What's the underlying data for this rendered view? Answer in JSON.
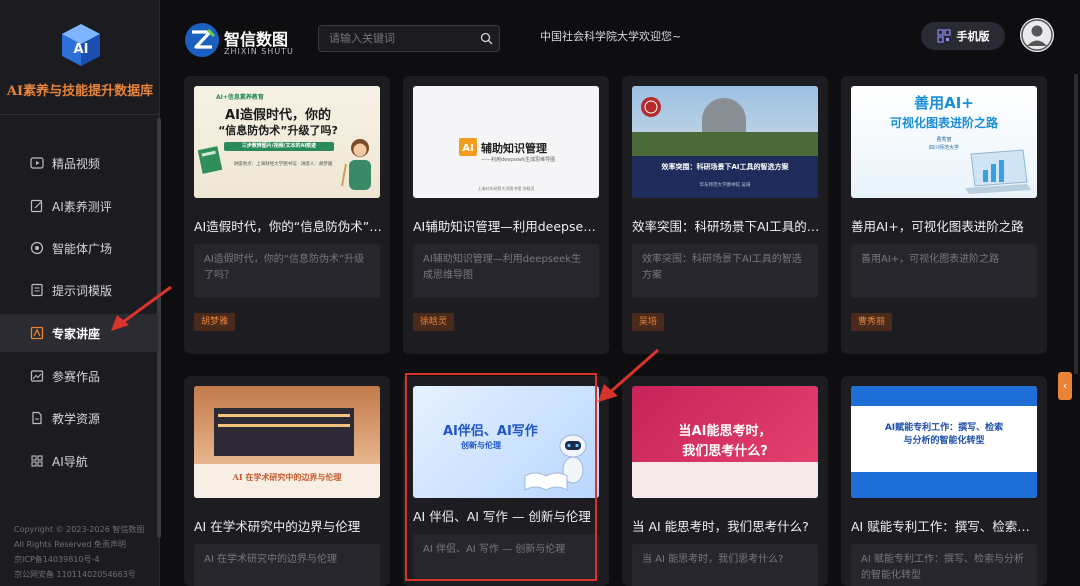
{
  "sidebar": {
    "brand_title": "AI素养与技能提升数据库",
    "items": [
      {
        "label": "精品视频",
        "icon": "video-icon"
      },
      {
        "label": "AI素养测评",
        "icon": "edit-icon"
      },
      {
        "label": "智能体广场",
        "icon": "agent-icon"
      },
      {
        "label": "提示词模版",
        "icon": "document-icon"
      },
      {
        "label": "专家讲座",
        "icon": "lecture-icon",
        "active": true
      },
      {
        "label": "参赛作品",
        "icon": "image-icon"
      },
      {
        "label": "教学资源",
        "icon": "file-icon"
      },
      {
        "label": "AI导航",
        "icon": "grid-icon"
      }
    ],
    "footer": [
      "Copyright © 2023-2026 智信数图",
      "All Rights Reserved 免责声明",
      "京ICP备14039810号-4",
      "京公网安备 11011402054663号"
    ]
  },
  "topbar": {
    "logo_name": "智信数图",
    "logo_sub": "ZHIXIN SHUTU",
    "search_placeholder": "请输入关键词",
    "welcome": "中国社会科学院大学欢迎您~",
    "mobile_label": "手机版"
  },
  "cards": [
    {
      "title": "AI造假时代，你的“信息防伪术”升级了吗？",
      "desc": "AI造假时代，你的“信息防伪术”升级了吗？",
      "tag": "胡梦雅",
      "thumb": {
        "badge": "AI+信息素养教育",
        "line1": "AI造假时代，你的",
        "line2": "“信息防伪术”升级了吗?",
        "sub": "三步教辨图片/视频/文本的AI痕迹",
        "meta": "讲座地点：上海财经大学图书馆 · 讲座人：胡梦雅"
      }
    },
    {
      "title": "AI辅助知识管理—利用deepseek生成思维导图",
      "desc": "AI辅助知识管理—利用deepseek生成思维导图",
      "tag": "徐晗灵",
      "thumb": {
        "ai": "AI",
        "line1": "辅助知识管理",
        "line2": "——利用deepseek生成思维导图",
        "meta": "上海对外经贸大学图书馆 徐晗灵"
      }
    },
    {
      "title": "效率突围：科研场景下AI工具的智选方案",
      "desc": "效率突围：科研场景下AI工具的智选方案",
      "tag": "吴培",
      "thumb": {
        "line1": "效率突围：科研场景下AI工具的智选方案",
        "meta": "华东师范大学图书馆 吴培"
      }
    },
    {
      "title": "善用AI+，可视化图表进阶之路",
      "desc": "善用AI+，可视化图表进阶之路",
      "tag": "曹秀丽",
      "thumb": {
        "line1": "善用AI+",
        "line2": "可视化图表进阶之路",
        "meta1": "曹秀丽",
        "meta2": "四川师范大学"
      }
    },
    {
      "title": "AI 在学术研究中的边界与伦理",
      "desc": "AI 在学术研究中的边界与伦理",
      "thumb": {
        "line1": "AI 在学术研究中的边界与伦理"
      }
    },
    {
      "title": "AI 伴侣、AI 写作 — 创新与伦理",
      "desc": "AI 伴侣、AI 写作 — 创新与伦理",
      "thumb": {
        "line1": "AI伴侣、AI写作",
        "line2": "创新与伦理"
      }
    },
    {
      "title": "当 AI 能思考时，我们思考什么?",
      "desc": "当 AI 能思考时，我们思考什么?",
      "thumb": {
        "line1": "当AI能思考时，",
        "line2": "我们思考什么?"
      }
    },
    {
      "title": "AI 赋能专利工作：撰写、检索与分析的智能化转型",
      "desc": "AI 赋能专利工作：撰写、检索与分析的智能化转型",
      "thumb": {
        "line1": "AI赋能专利工作：撰写、检索",
        "line2": "与分析的智能化转型"
      }
    }
  ],
  "colors": {
    "accent": "#e8833a",
    "highlight": "#d9342b",
    "bg": "#0e0e10",
    "card": "#1c1c21"
  }
}
